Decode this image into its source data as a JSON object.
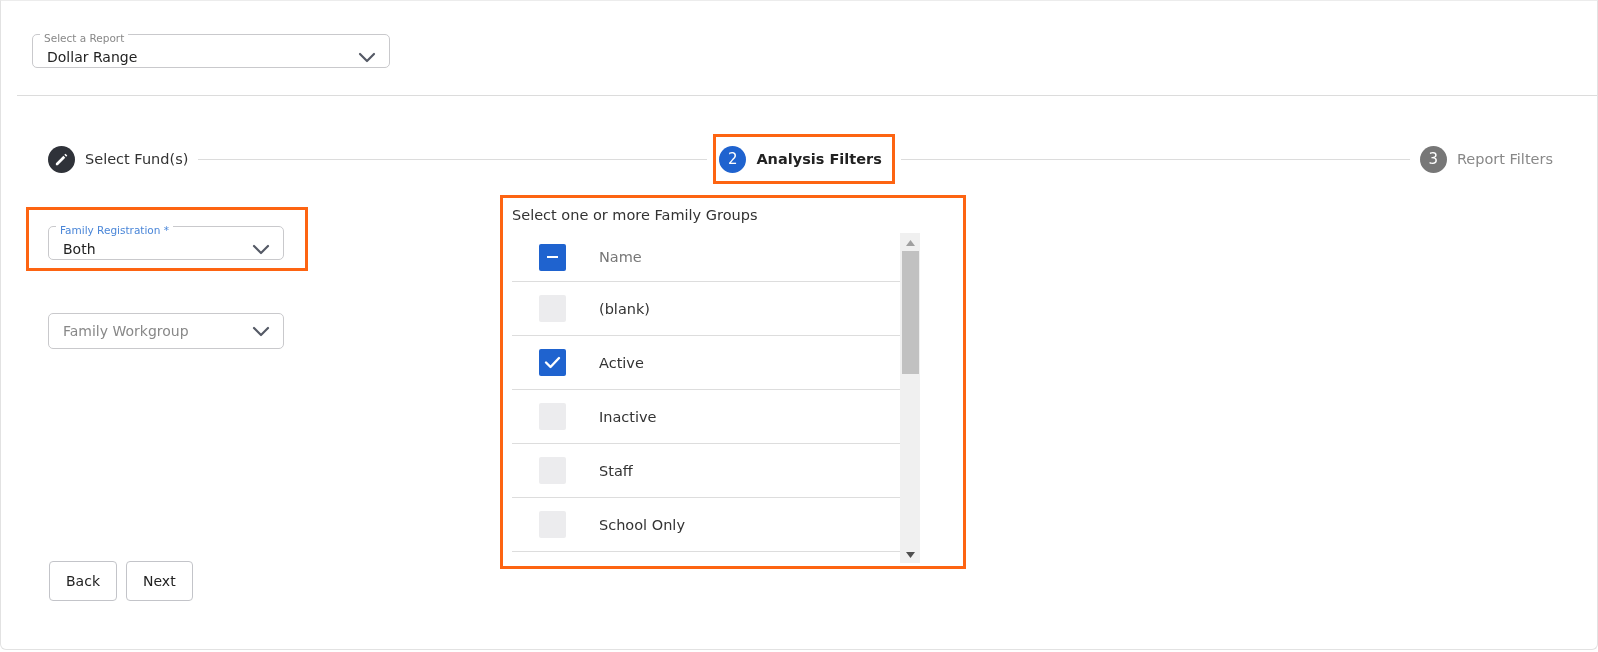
{
  "report_select": {
    "label": "Select a Report",
    "value": "Dollar Range"
  },
  "steps": [
    {
      "label": "Select Fund(s)",
      "completed": true,
      "selected": false,
      "highlighted": false
    },
    {
      "number": "2",
      "label": "Analysis Filters",
      "completed": false,
      "selected": true,
      "highlighted": true
    },
    {
      "number": "3",
      "label": "Report Filters",
      "completed": false,
      "selected": false,
      "highlighted": false
    }
  ],
  "filters": [
    {
      "label": "Family Registration *",
      "value": "Both",
      "highlighted": true
    },
    {
      "placeholder": "Family Workgroup",
      "highlighted": false
    }
  ],
  "family_groups": {
    "title": "Select one or more Family Groups",
    "highlighted": true,
    "rows": [
      {
        "kind": "header",
        "label": "Name",
        "indeterminate": true
      },
      {
        "kind": "item",
        "label": "(blank)",
        "checked": false
      },
      {
        "kind": "item",
        "label": "Active",
        "checked": true
      },
      {
        "kind": "item",
        "label": "Inactive",
        "checked": false
      },
      {
        "kind": "item",
        "label": "Staff",
        "checked": false
      },
      {
        "kind": "item",
        "label": "School Only",
        "checked": false
      }
    ]
  },
  "buttons": [
    "Back",
    "Next"
  ]
}
